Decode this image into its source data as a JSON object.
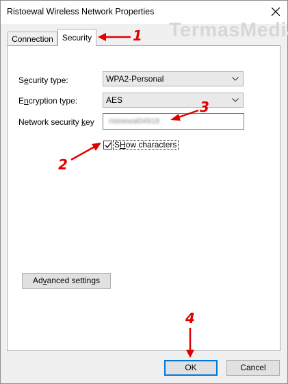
{
  "window": {
    "title": "Ristoewal Wireless Network Properties",
    "watermark": "TermasMedia"
  },
  "tabs": [
    {
      "label": "Connection",
      "active": false
    },
    {
      "label": "Security",
      "active": true
    }
  ],
  "form": {
    "security_type": {
      "label_pre": "S",
      "label_ul": "e",
      "label_post": "curity type:",
      "value": "WPA2-Personal"
    },
    "encryption_type": {
      "label_pre": "E",
      "label_ul": "n",
      "label_post": "cryption type:",
      "value": "AES"
    },
    "network_key": {
      "label_pre": "Network security ",
      "label_ul": "k",
      "label_post": "ey",
      "value": "ristoewal04918"
    },
    "show_characters": {
      "label_ul": "H",
      "label_pre": "S",
      "label_post": "ow characters",
      "checked": true
    }
  },
  "buttons": {
    "advanced_pre": "Ad",
    "advanced_ul": "v",
    "advanced_post": "anced settings",
    "ok": "OK",
    "cancel": "Cancel"
  },
  "annotations": {
    "step1": "1",
    "step2": "2",
    "step3": "3",
    "step4": "4",
    "color": "#e00000"
  },
  "colors": {
    "focus_blue": "#0078d7",
    "dialog_bg": "#f0f0f0"
  }
}
